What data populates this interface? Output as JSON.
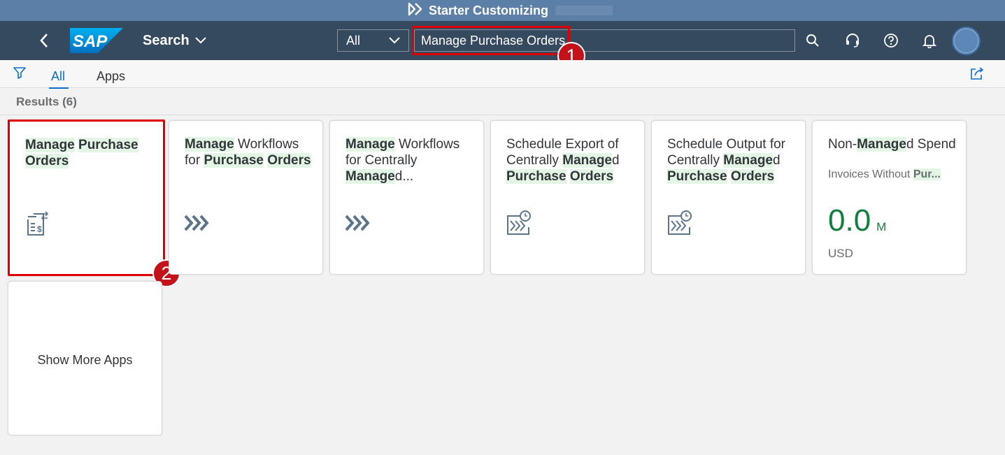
{
  "titlebar": {
    "title": "Starter Customizing",
    "icon": "forward-arrows-icon"
  },
  "shellbar": {
    "back_icon": "chevron-left-icon",
    "logo_text": "SAP",
    "nav_label": "Search",
    "scope_value": "All",
    "search_value": "Manage Purchase Orders",
    "icons": [
      "search-icon",
      "headset-icon",
      "help-icon",
      "bell-icon"
    ],
    "avatar": "user-avatar"
  },
  "annotations": {
    "marker_1": "1",
    "marker_2": "2"
  },
  "tabs": [
    {
      "label": "All"
    },
    {
      "label": "Apps"
    }
  ],
  "results": {
    "header": "Results (6)"
  },
  "tiles": [
    {
      "title": [
        {
          "text": "Manage",
          "hl": true
        },
        {
          "text": " ",
          "hl": false
        },
        {
          "text": "Purchase",
          "hl": true
        },
        {
          "text": " ",
          "hl": false
        },
        {
          "text": "Orders",
          "hl": true
        }
      ],
      "icon": "purchase-order-icon"
    },
    {
      "title": [
        {
          "text": "Manage",
          "hl": true
        },
        {
          "text": " Workflows for ",
          "hl": false
        },
        {
          "text": "Purchase",
          "hl": true
        },
        {
          "text": " ",
          "hl": false
        },
        {
          "text": "Orders",
          "hl": true
        }
      ],
      "icon": "process-chevrons-icon"
    },
    {
      "title": [
        {
          "text": "Manage",
          "hl": true
        },
        {
          "text": " Workflows for Centrally ",
          "hl": false
        },
        {
          "text": "Manage",
          "hl": true
        },
        {
          "text": "d...",
          "hl": false
        }
      ],
      "icon": "process-chevrons-icon"
    },
    {
      "title": [
        {
          "text": "Schedule Export of Centrally ",
          "hl": false
        },
        {
          "text": "Manage",
          "hl": true
        },
        {
          "text": "d ",
          "hl": false
        },
        {
          "text": "Purchase",
          "hl": true
        },
        {
          "text": " ",
          "hl": false
        },
        {
          "text": "Orders",
          "hl": true
        }
      ],
      "icon": "scheduled-process-icon"
    },
    {
      "title": [
        {
          "text": "Schedule Output for Centrally ",
          "hl": false
        },
        {
          "text": "Manage",
          "hl": true
        },
        {
          "text": "d ",
          "hl": false
        },
        {
          "text": "Purchase",
          "hl": true
        },
        {
          "text": " ",
          "hl": false
        },
        {
          "text": "Orders",
          "hl": true
        }
      ],
      "icon": "scheduled-process-icon"
    },
    {
      "title": [
        {
          "text": "Non-",
          "hl": false
        },
        {
          "text": "Manage",
          "hl": true
        },
        {
          "text": "d Spend",
          "hl": false
        }
      ],
      "subtitle": [
        {
          "text": "Invoices Without ",
          "hl": false
        },
        {
          "text": "Pur...",
          "hl": true
        }
      ],
      "kpi": {
        "value": "0.0",
        "scale": "M",
        "unit": "USD"
      }
    }
  ],
  "show_more": {
    "label": "Show More Apps"
  },
  "colors": {
    "shell": "#354a5f",
    "titlebar": "#5b7fa6",
    "accent": "#0a6ed1",
    "highlight": "#e3f6e6",
    "kpi": "#107e3e",
    "annotation": "#e00000"
  }
}
